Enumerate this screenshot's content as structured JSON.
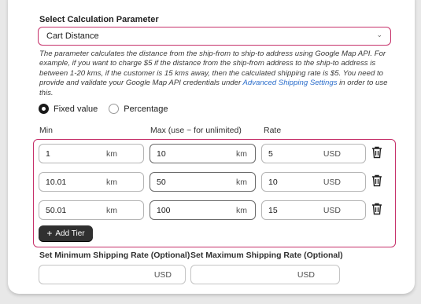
{
  "section_title": "Select Calculation Parameter",
  "parameter_select": {
    "value": "Cart Distance"
  },
  "description": {
    "text": "The parameter calculates the distance from the ship-from to ship-to address using Google Map API. For example, if you want to charge $5 if the distance from the ship-from address to the ship-to address is between 1-20 kms, if the customer is 15 kms away, then the calculated shipping rate is $5. You need to provide and validate your Google Map API credentials under ",
    "link": "Advanced Shipping Settings",
    "suffix": " in order to use this."
  },
  "rate_type": {
    "options": [
      {
        "label": "Fixed value",
        "selected": true
      },
      {
        "label": "Percentage",
        "selected": false
      }
    ]
  },
  "columns": {
    "min": "Min",
    "max": "Max (use ~ for unlimited)",
    "rate": "Rate"
  },
  "units": {
    "distance": "km",
    "currency": "USD"
  },
  "tiers": [
    {
      "min": "1",
      "max": "10",
      "rate": "5"
    },
    {
      "min": "10.01",
      "max": "50",
      "rate": "10"
    },
    {
      "min": "50.01",
      "max": "100",
      "rate": "15"
    }
  ],
  "add_tier_label": "Add Tier",
  "min_shipping": {
    "label": "Set Minimum Shipping Rate (Optional)",
    "value": ""
  },
  "max_shipping": {
    "label": "Set Maximum Shipping Rate (Optional)",
    "value": ""
  },
  "colors": {
    "accent": "#c6316a",
    "button": "#303030",
    "link": "#2c6ecb"
  },
  "icons": {
    "select_chevron": "chevron-down-icon",
    "delete": "trash-icon",
    "add": "plus-icon"
  }
}
